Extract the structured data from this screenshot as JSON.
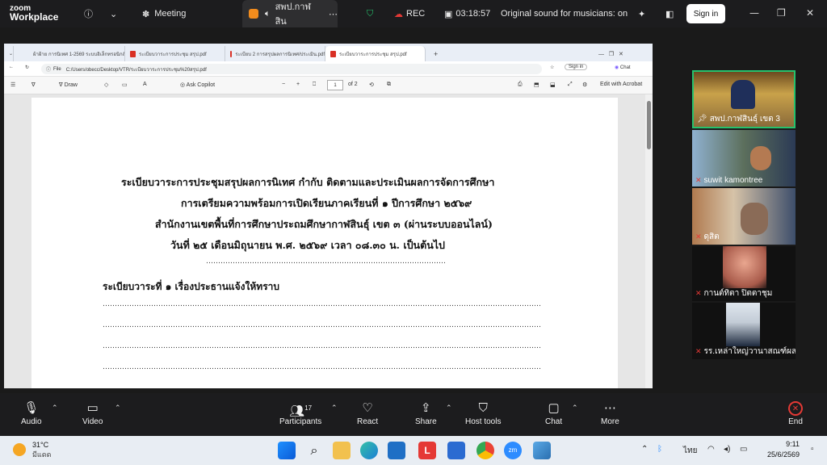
{
  "zoom": {
    "logo_line1": "zoom",
    "logo_line2": "Workplace",
    "meeting_label": "Meeting",
    "active_tab": "สพป.กาฬสิน",
    "rec_label": "REC",
    "timer": "03:18:57",
    "audio_status": "Original sound for musicians: on",
    "signin": "Sign in"
  },
  "browser": {
    "tabs": [
      {
        "title": "ผ้าฝ้าย การนิเทศ 1-2569 ระบบอิเล็กทรอนิกส์"
      },
      {
        "title": "ระเบียบวาระการประชุม สรุป.pdf"
      },
      {
        "title": "ระเบียบ 2 การสรุปผลการนิเทศ/ประเมิน.pdf"
      },
      {
        "title": "ระเบียบวาระการประชุม สรุป.pdf"
      }
    ],
    "address_prefix": "File",
    "address": "C:/Users/obecc/Desktop/VTR/ระเบียบวาระการประชุม%20สรุป.pdf",
    "signin": "Sign in",
    "chat": "Chat"
  },
  "pdf_toolbar": {
    "draw": "Draw",
    "ask_copilot": "Ask Copilot",
    "minus": "−",
    "plus": "+",
    "page": "1",
    "of_pages": "of 2",
    "edit_acrobat": "Edit with Acrobat"
  },
  "document": {
    "line1": "ระเบียบวาระการประชุมสรุปผลการนิเทศ กำกับ ติดตามและประเมินผลการจัดการศึกษา",
    "line2": "การเตรียมความพร้อมการเปิดเรียนภาคเรียนที่ ๑ ปีการศึกษา ๒๕๖๙",
    "line3": "สำนักงานเขตพื้นที่การศึกษาประถมศึกษากาฬสินธุ์ เขต ๓ (ผ่านระบบออนไลน์)",
    "line4": "วันที่ ๒๕ เดือนมิถุนายน พ.ศ. ๒๕๖๙ เวลา ๐๘.๓๐ น. เป็นต้นไป",
    "agenda1": "ระเบียบวาระที่ ๑  เรื่องประธานแจ้งให้ทราบ"
  },
  "participants": [
    {
      "name": "สพป.กาฬสินธุ์ เขต 3"
    },
    {
      "name": "suwit kamontree"
    },
    {
      "name": "ดุสิต"
    },
    {
      "name": "กานต์ทิตา  ปิตตาชุม"
    },
    {
      "name": "รร.เหล่าใหญ่วานาสณฑ์ผล..."
    }
  ],
  "toolbar": {
    "audio": "Audio",
    "video": "Video",
    "participants": "Participants",
    "participants_count": "17",
    "react": "React",
    "share": "Share",
    "host_tools": "Host tools",
    "chat": "Chat",
    "more": "More",
    "end": "End"
  },
  "taskbar": {
    "temp": "31°C",
    "weather": "มีแดด",
    "lang": "ไทย",
    "time": "9:11",
    "date": "25/6/2569"
  },
  "colors": {
    "zoom_bg": "#1c1c1e",
    "accent_green": "#26c26d",
    "end_red": "#e53935",
    "pdf_red": "#d93025"
  }
}
